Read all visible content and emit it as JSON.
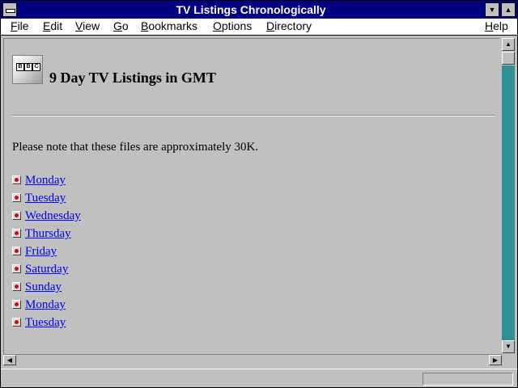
{
  "window": {
    "title": "TV Listings Chronologically"
  },
  "menu": {
    "file": {
      "acc": "F",
      "rest": "ile"
    },
    "edit": {
      "acc": "E",
      "rest": "dit"
    },
    "view": {
      "acc": "V",
      "rest": "iew"
    },
    "go": {
      "acc": "G",
      "rest": "o"
    },
    "bookmarks": {
      "acc": "B",
      "rest": "ookmarks"
    },
    "options": {
      "acc": "O",
      "rest": "ptions"
    },
    "directory": {
      "acc": "D",
      "rest": "irectory"
    },
    "help": {
      "acc": "H",
      "rest": "elp"
    }
  },
  "page": {
    "logo_letters": [
      "B",
      "B",
      "C"
    ],
    "heading": "9 Day TV Listings in GMT",
    "note": "Please note that these files are approximately 30K.",
    "days": [
      "Monday",
      "Tuesday",
      "Wednesday",
      "Thursday",
      "Friday",
      "Saturday",
      "Sunday",
      "Monday",
      "Tuesday"
    ]
  },
  "icons": {
    "system_menu": "system-menu-icon",
    "minimize": "minimize-icon",
    "maximize": "maximize-icon",
    "logo": "bbc-logo",
    "bullet": "bullet-icon"
  },
  "colors": {
    "titlebar": "#000080",
    "link": "#0000ee",
    "background": "#c0c0c0",
    "bullet_dot": "#c01010",
    "scroll_track": "#008080"
  }
}
